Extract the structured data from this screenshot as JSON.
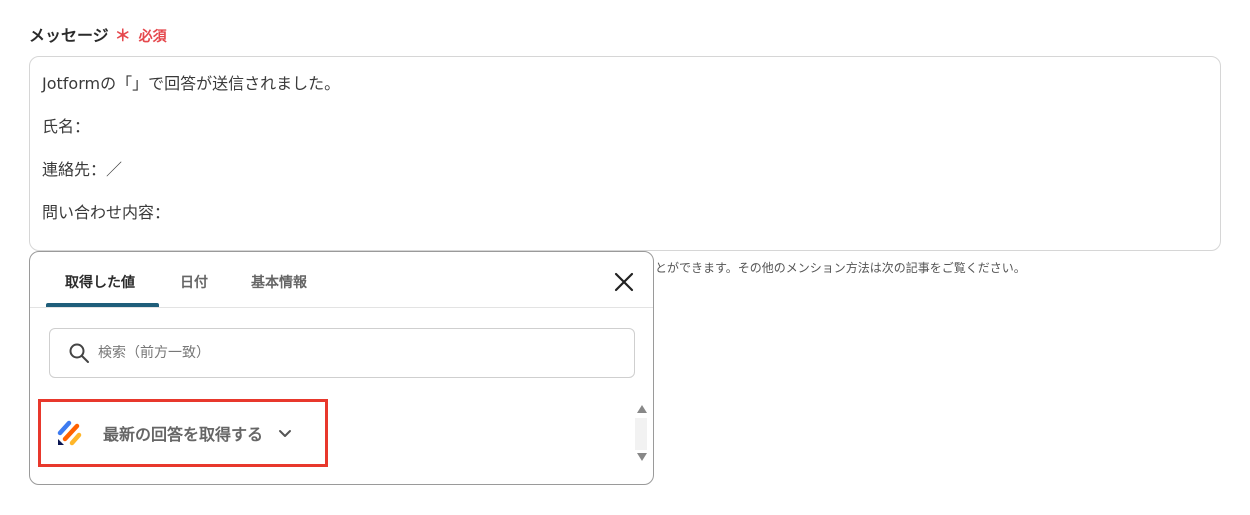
{
  "field": {
    "label": "メッセージ",
    "required_mark": "＊",
    "required_text": "必須"
  },
  "message": {
    "lines": [
      "Jotformの「」で回答が送信されました。",
      "氏名：",
      "連絡先：／",
      "問い合わせ内容："
    ]
  },
  "helper_text": "とができます。その他のメンション方法は次の記事をご覧ください。",
  "popup": {
    "tabs": [
      {
        "label": "取得した値",
        "active": true
      },
      {
        "label": "日付",
        "active": false
      },
      {
        "label": "基本情報",
        "active": false
      }
    ],
    "search": {
      "placeholder": "検索（前方一致）",
      "value": ""
    },
    "list": [
      {
        "label": "最新の回答を取得する",
        "icon": "jotform-logo-icon",
        "expanded": false
      }
    ]
  },
  "colors": {
    "accent": "#1f5e7a",
    "required": "#e5484d",
    "highlight": "#e8382c"
  }
}
